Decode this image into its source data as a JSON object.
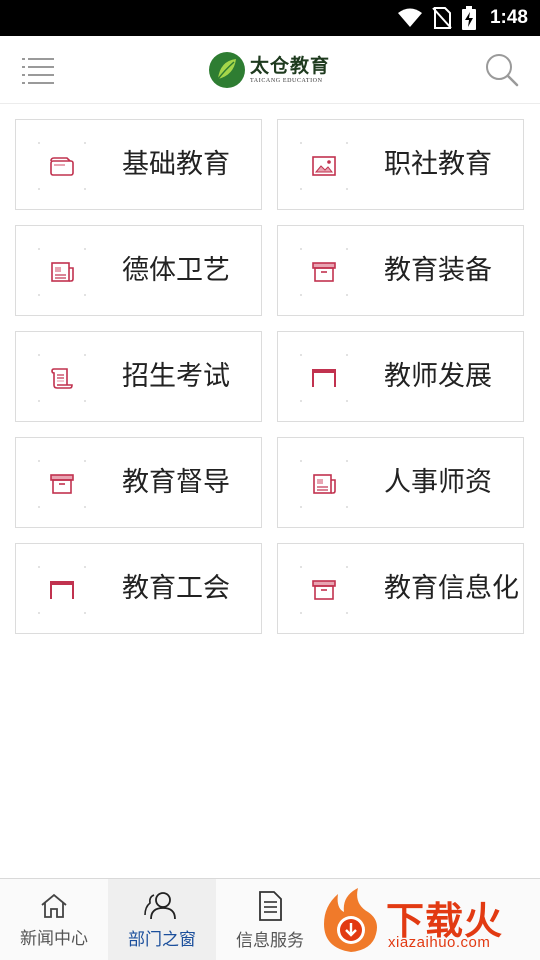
{
  "status_bar": {
    "time": "1:48"
  },
  "header": {
    "logo_title": "太仓教育",
    "logo_subtitle": "TAICANG EDUCATION",
    "menu_icon": "menu-lines-icon",
    "search_icon": "search-icon"
  },
  "departments": [
    {
      "label": "基础教育",
      "icon": "wallet-icon"
    },
    {
      "label": "职社教育",
      "icon": "image-icon"
    },
    {
      "label": "德体卫艺",
      "icon": "newspaper-icon"
    },
    {
      "label": "教育装备",
      "icon": "archive-icon"
    },
    {
      "label": "招生考试",
      "icon": "scroll-icon"
    },
    {
      "label": "教师发展",
      "icon": "frame-icon"
    },
    {
      "label": "教育督导",
      "icon": "archive-icon"
    },
    {
      "label": "人事师资",
      "icon": "newspaper-icon"
    },
    {
      "label": "教育工会",
      "icon": "frame-icon"
    },
    {
      "label": "教育信息化",
      "icon": "archive-icon"
    }
  ],
  "tabs": [
    {
      "label": "新闻中心",
      "icon": "home-icon",
      "active": false
    },
    {
      "label": "部门之窗",
      "icon": "users-icon",
      "active": true
    },
    {
      "label": "信息服务",
      "icon": "document-icon",
      "active": false
    }
  ],
  "watermark": {
    "text": "下载火",
    "url": "xiazaihuo.com"
  },
  "colors": {
    "icon_accent": "#c1324f",
    "active_tab": "#1b4f9c",
    "logo_green": "#2e7d32",
    "watermark": "#e23a12"
  }
}
